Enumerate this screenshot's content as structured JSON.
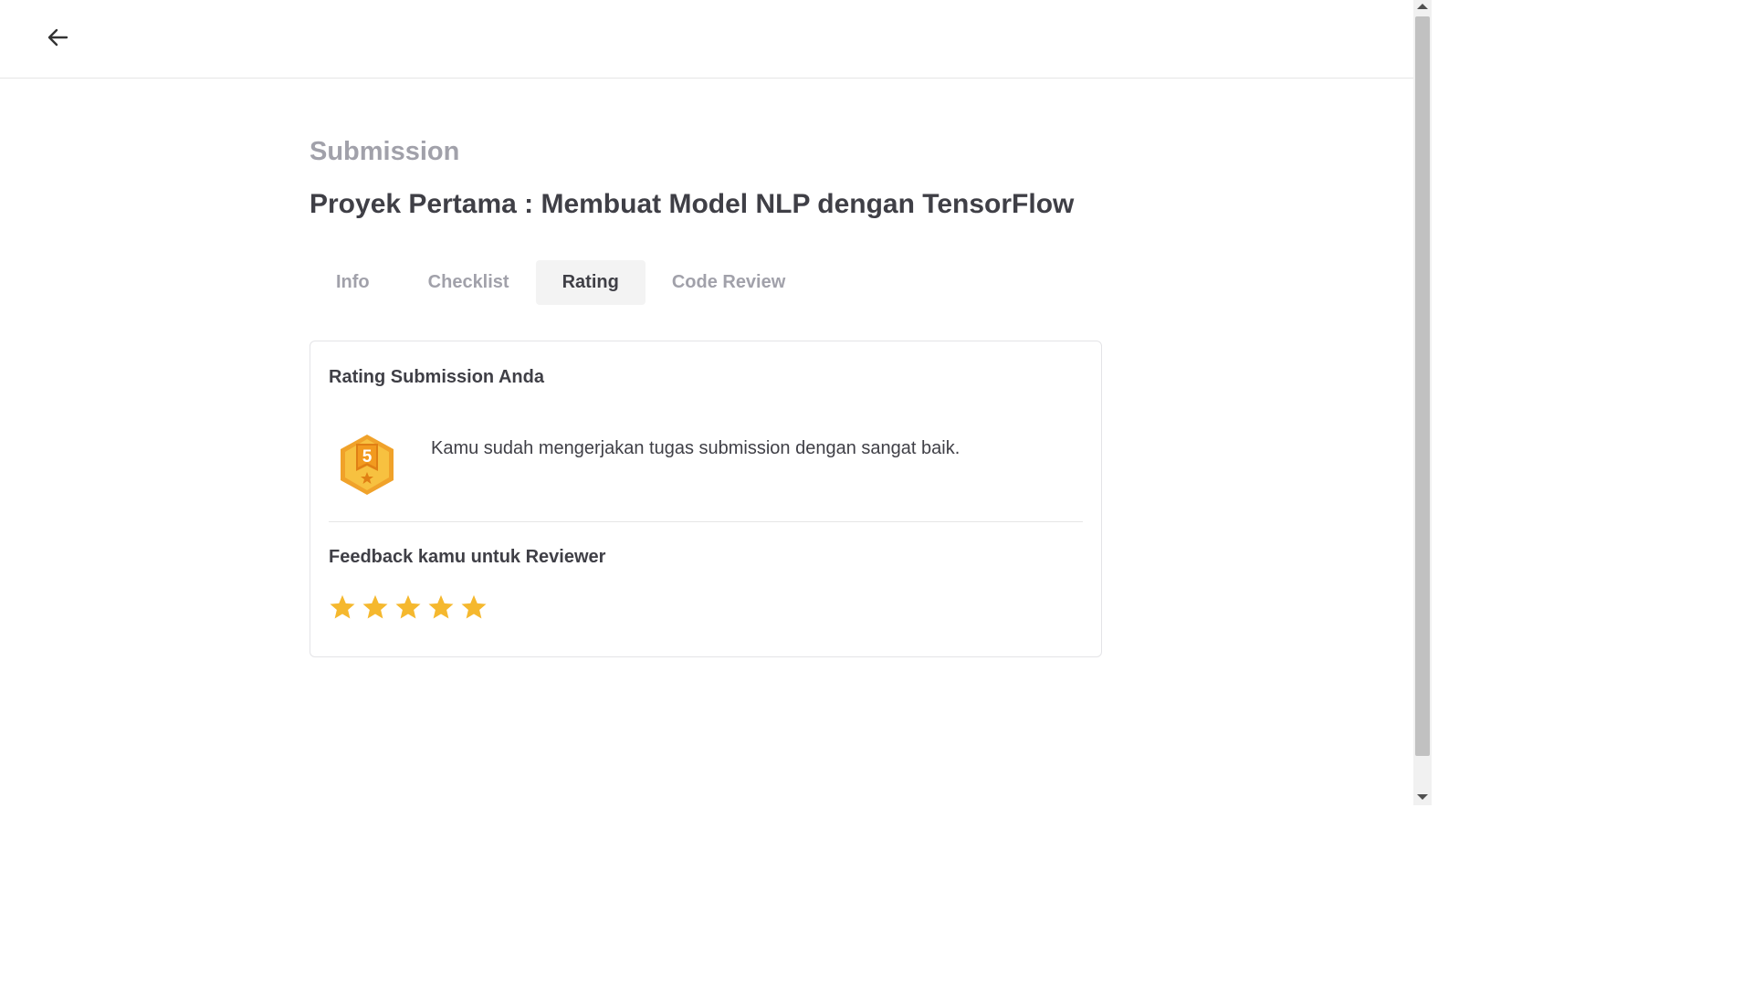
{
  "header": {
    "back_icon": "arrow-left-icon"
  },
  "page": {
    "eyebrow": "Submission",
    "title": "Proyek Pertama : Membuat Model NLP dengan TensorFlow"
  },
  "tabs": [
    {
      "label": "Info",
      "active": false
    },
    {
      "label": "Checklist",
      "active": false
    },
    {
      "label": "Rating",
      "active": true
    },
    {
      "label": "Code Review",
      "active": false
    }
  ],
  "rating_card": {
    "heading": "Rating Submission Anda",
    "badge_value": "5",
    "badge_icon": "hexagon-rating-badge-icon",
    "message": "Kamu sudah mengerjakan tugas submission dengan sangat baik.",
    "feedback_heading": "Feedback kamu untuk Reviewer",
    "stars_filled": 5,
    "stars_total": 5
  },
  "colors": {
    "accent_gold": "#f5b82e",
    "badge_orange": "#e8921c",
    "muted_text": "#a1a1aa",
    "main_text": "#3f3f46"
  }
}
